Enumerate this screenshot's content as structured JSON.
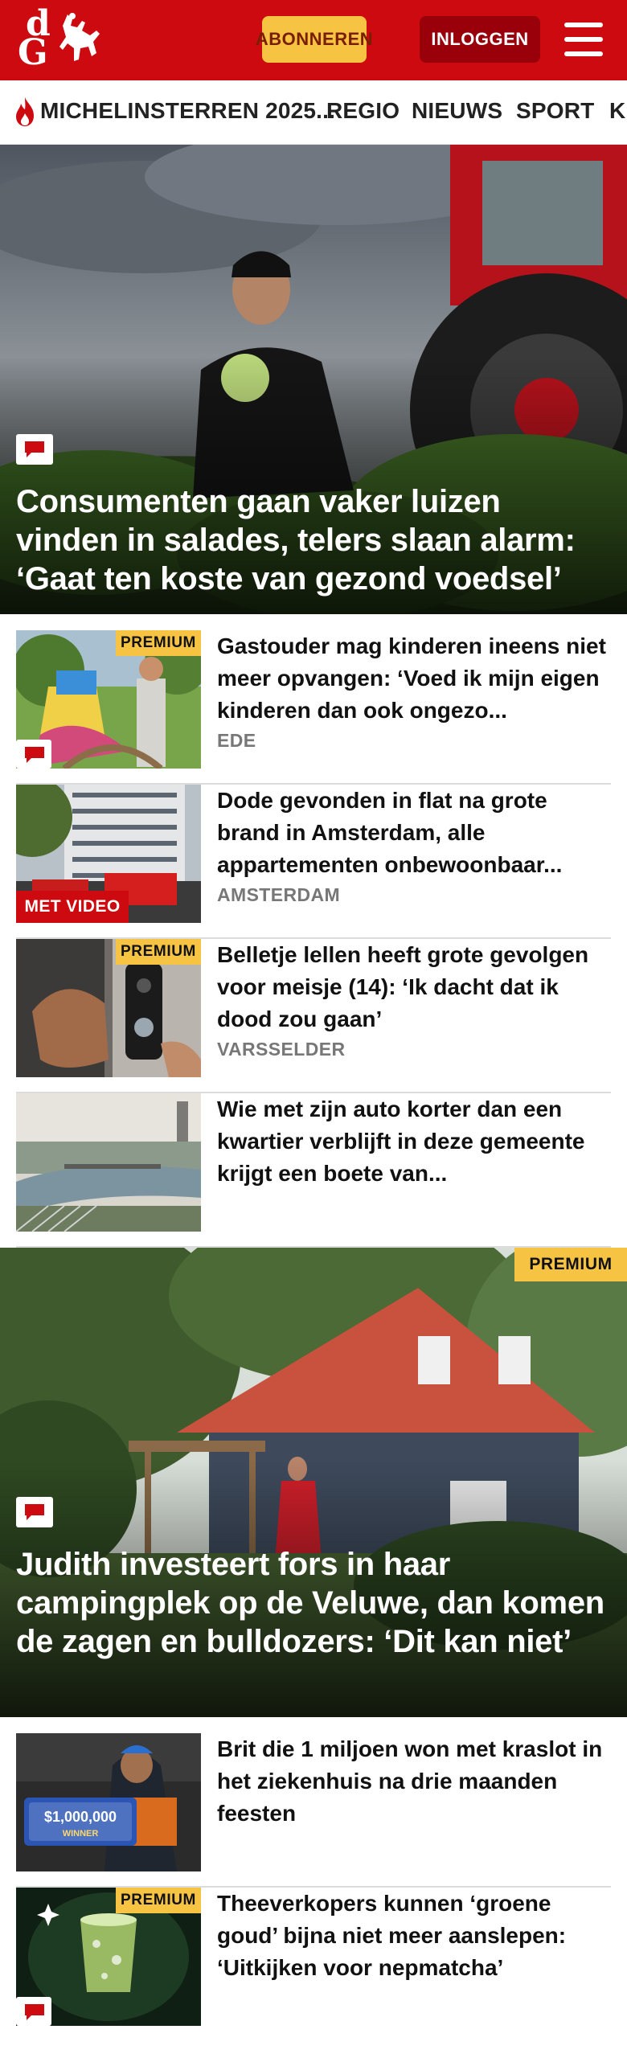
{
  "brand": {
    "logo_text_top": "d",
    "logo_text_bottom": "G",
    "color": "#cc0a0f"
  },
  "header": {
    "subscribe_label": "ABONNEREN",
    "login_label": "INLOGGEN",
    "menu_icon": "hamburger-icon"
  },
  "nav": {
    "items": [
      {
        "label": "MICHELINSTERREN 2025...",
        "icon": "flame-icon"
      },
      {
        "label": "REGIO"
      },
      {
        "label": "NIEUWS"
      },
      {
        "label": "SPORT"
      },
      {
        "label": "K"
      }
    ]
  },
  "hero1": {
    "title": "Consumenten gaan vaker luizen vinden in salades, telers slaan alarm: ‘Gaat ten koste van gezond voedsel’",
    "comment_icon": "comment-icon"
  },
  "articles": [
    {
      "title": "Gastouder mag kinderen ineens niet meer opvangen: ‘Voed ik mijn eigen kinderen dan ook ongezo...",
      "location": "EDE",
      "badge": "PREMIUM",
      "comment_icon": "comment-icon"
    },
    {
      "title": "Dode gevonden in flat na grote brand in Amsterdam, alle appartementen onbewoonbaar...",
      "location": "AMSTERDAM",
      "video_badge": "MET VIDEO"
    },
    {
      "title": "Belletje lellen heeft grote gevolgen voor meisje (14): ‘Ik dacht dat ik dood zou gaan’",
      "location": "VARSSELDER",
      "badge": "PREMIUM"
    },
    {
      "title": "Wie met zijn auto korter dan een kwartier verblijft in deze gemeente krijgt een boete van...",
      "location": ""
    }
  ],
  "hero2": {
    "title": "Judith investeert fors in haar campingplek op de Veluwe, dan komen de zagen en bulldozers: ‘Dit kan niet’",
    "badge": "PREMIUM",
    "comment_icon": "comment-icon"
  },
  "articles2": [
    {
      "title": "Brit die 1 miljoen won met kraslot in het ziekenhuis na drie maanden feesten",
      "image_text": "$1,000,000",
      "image_subtext": "WINNER"
    },
    {
      "title": "Theeverkopers kunnen ‘groene goud’ bijna niet meer aanslepen: ‘Uitkijken voor nepmatcha’",
      "badge": "PREMIUM",
      "comment_icon": "comment-icon"
    }
  ]
}
